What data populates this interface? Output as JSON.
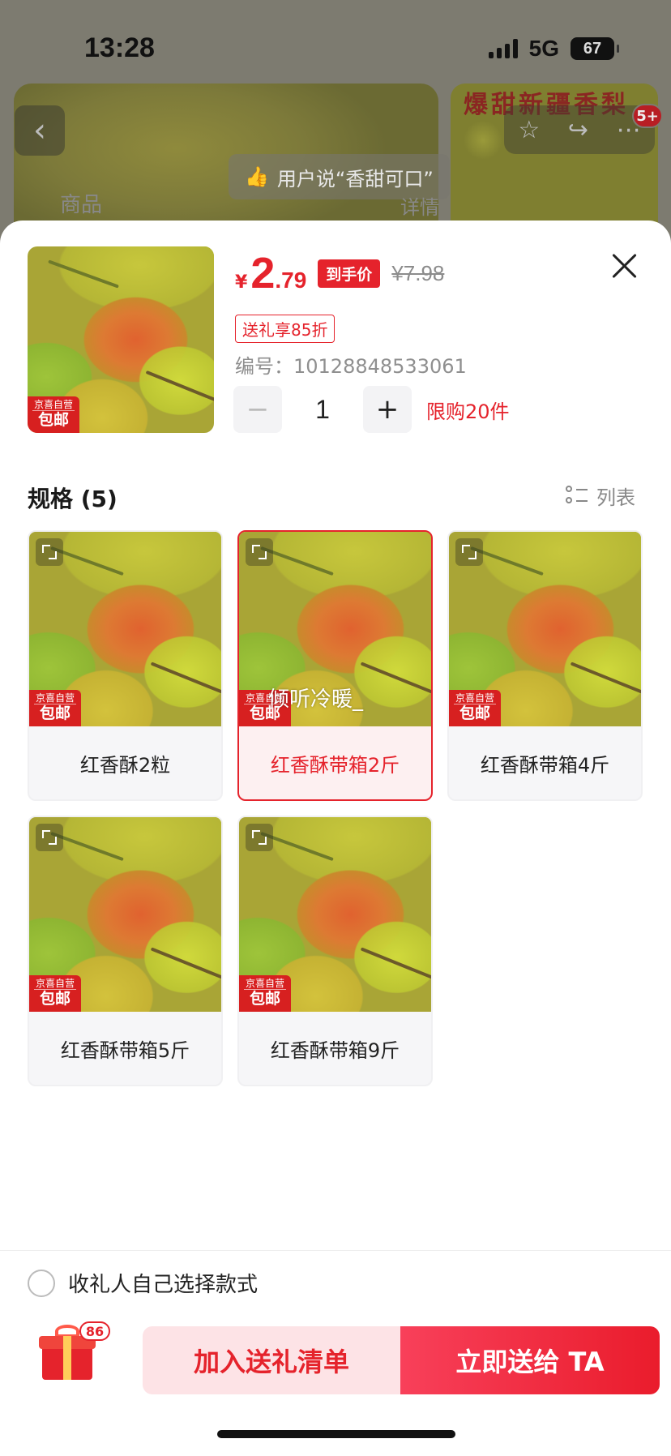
{
  "status_bar": {
    "time": "13:28",
    "network": "5G",
    "battery": "67"
  },
  "background": {
    "side_title": "爆甜新疆香梨",
    "cart_badge": "5+",
    "review_text": "用户说“香甜可口”",
    "tab_product": "商品",
    "tab_detail": "详情"
  },
  "sheet": {
    "price": {
      "currency": "¥",
      "integer": "2",
      "decimal": ".79",
      "tag": "到手价",
      "original": "¥7.98"
    },
    "discount_tag": "送礼享85折",
    "sku_number": "编号：10128848533061",
    "quantity": {
      "minus": "−",
      "value": "1",
      "plus": "+",
      "limit": "限购20件"
    },
    "badge": {
      "small": "京喜自营",
      "big": "包邮"
    },
    "spec_title": "规格 (5)",
    "list_toggle": "列表",
    "options": [
      {
        "label": "红香酥2粒",
        "selected": false
      },
      {
        "label": "红香酥带箱2斤",
        "selected": true,
        "watermark": "倾听冷暖_"
      },
      {
        "label": "红香酥带箱4斤",
        "selected": false
      },
      {
        "label": "红香酥带箱5斤",
        "selected": false
      },
      {
        "label": "红香酥带箱9斤",
        "selected": false
      }
    ],
    "recipient_option": "收礼人自己选择款式",
    "gift_count": "86",
    "add_button": "加入送礼清单",
    "send_button": "立即送给 TA"
  },
  "colors": {
    "accent": "#e5232c",
    "selected_bg": "#fdf0f1",
    "add_bg": "#fde3e6"
  }
}
